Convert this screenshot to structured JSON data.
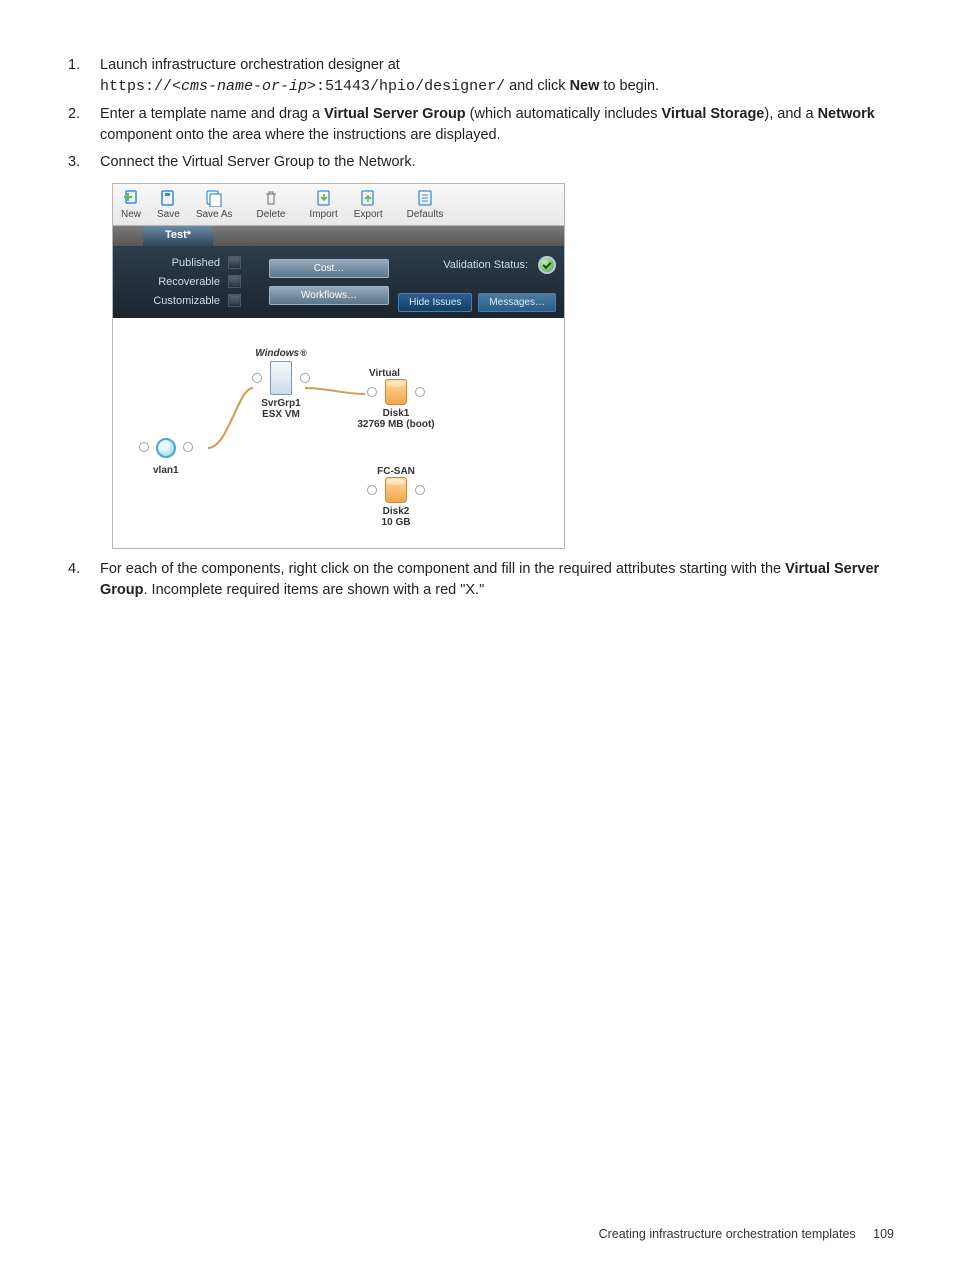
{
  "steps": {
    "s1a": "Launch infrastructure orchestration designer at",
    "s1_url_a": "https://",
    "s1_url_b": "<cms-name-or-ip>",
    "s1_url_c": ":51443/hpio/designer/",
    "s1b": " and click ",
    "s1_new": "New",
    "s1c": " to begin.",
    "s2a": "Enter a template name and drag a ",
    "s2_vs": "Virtual Server Group",
    "s2b": " (which automatically includes ",
    "s2_vstor": "Virtual Storage",
    "s2c": "), and a ",
    "s2_net": "Network",
    "s2d": " component onto the area where the instructions are displayed.",
    "s3": "Connect the Virtual Server Group to the Network.",
    "s4a": "For each of the components, right click on the component and fill in the required attributes starting with the ",
    "s4_vs": "Virtual Server Group",
    "s4b": ". Incomplete required items are shown with a red \"X.\""
  },
  "toolbar": {
    "new": "New",
    "save": "Save",
    "saveas": "Save As",
    "delete": "Delete",
    "import": "Import",
    "export": "Export",
    "defaults": "Defaults"
  },
  "tab": "Test*",
  "props": {
    "published": "Published",
    "recoverable": "Recoverable",
    "customizable": "Customizable"
  },
  "buttons": {
    "cost": "Cost…",
    "workflows": "Workflows…",
    "hide": "Hide Issues",
    "messages": "Messages…",
    "vstat": "Validation Status:"
  },
  "diagram": {
    "windows": "Windows",
    "svr1": "SvrGrp1",
    "svr2": "ESX VM",
    "virtual": "Virtual",
    "disk1a": "Disk1",
    "disk1b": "32769 MB (boot)",
    "fc": "FC-SAN",
    "disk2a": "Disk2",
    "disk2b": "10 GB",
    "vlan": "vlan1"
  },
  "footer": {
    "text": "Creating infrastructure orchestration templates",
    "page": "109"
  }
}
